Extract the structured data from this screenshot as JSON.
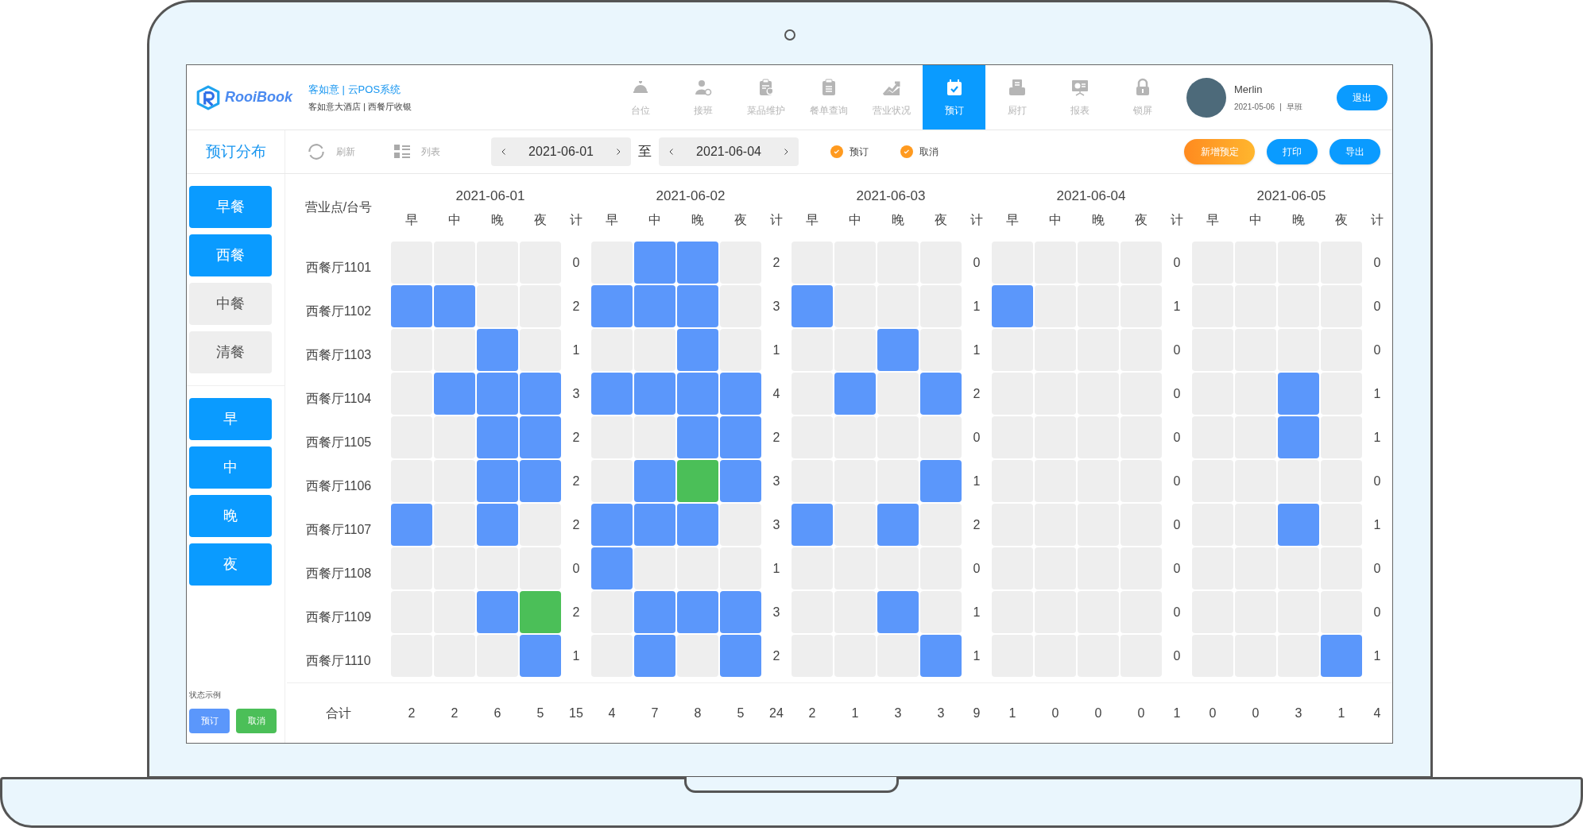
{
  "app": {
    "logo_text": "RooiBook",
    "title": "客如意 | 云POS系统",
    "subtitle": "客如意大酒店 | 西餐厅收银"
  },
  "nav": [
    {
      "label": "台位",
      "selected": false
    },
    {
      "label": "接班",
      "selected": false
    },
    {
      "label": "菜品维护",
      "selected": false
    },
    {
      "label": "餐单查询",
      "selected": false
    },
    {
      "label": "营业状况",
      "selected": false
    },
    {
      "label": "预订",
      "selected": true
    },
    {
      "label": "厨打",
      "selected": false
    },
    {
      "label": "报表",
      "selected": false
    },
    {
      "label": "锁屏",
      "selected": false
    }
  ],
  "user": {
    "name": "Merlin",
    "date": "2021-05-06",
    "separator": "|",
    "shift": "早班",
    "logout": "退出"
  },
  "page_title": "预订分布",
  "toolbar": {
    "refresh": "刷新",
    "list": "列表",
    "start_date": "2021-06-01",
    "to": "至",
    "end_date": "2021-06-04",
    "filters": [
      {
        "label": "预订",
        "checked": true
      },
      {
        "label": "取消",
        "checked": true
      }
    ],
    "buttons": [
      {
        "label": "新增预定",
        "kind": "accent"
      },
      {
        "label": "打印",
        "kind": "primary"
      },
      {
        "label": "导出",
        "kind": "primary"
      }
    ]
  },
  "sidebar": {
    "meals": [
      {
        "label": "早餐",
        "selected": true
      },
      {
        "label": "西餐",
        "selected": true
      },
      {
        "label": "中餐",
        "selected": false
      },
      {
        "label": "清餐",
        "selected": false
      }
    ],
    "shifts": [
      {
        "label": "早",
        "selected": true
      },
      {
        "label": "中",
        "selected": true
      },
      {
        "label": "晚",
        "selected": true
      },
      {
        "label": "夜",
        "selected": true
      }
    ],
    "legend_title": "状态示例",
    "legend": [
      {
        "label": "预订",
        "color": "#5b97fb"
      },
      {
        "label": "取消",
        "color": "#4bbf58"
      }
    ]
  },
  "grid": {
    "corner": "营业点/台号",
    "days": [
      {
        "date": "2021-06-01",
        "slots": [
          "早",
          "中",
          "晚",
          "夜"
        ],
        "total_label": "计"
      },
      {
        "date": "2021-06-02",
        "slots": [
          "早",
          "中",
          "晚",
          "夜"
        ],
        "total_label": "计"
      },
      {
        "date": "2021-06-03",
        "slots": [
          "早",
          "中",
          "晚",
          "夜"
        ],
        "total_label": "计"
      },
      {
        "date": "2021-06-04",
        "slots": [
          "早",
          "中",
          "晚",
          "夜"
        ],
        "total_label": "计"
      },
      {
        "date": "2021-06-05",
        "slots": [
          "早",
          "中",
          "晚",
          "夜"
        ],
        "total_label": "计"
      }
    ],
    "rows": [
      {
        "name": "西餐厅1101",
        "days": [
          {
            "slots": [
              {
                "kind": "free"
              },
              {
                "kind": "free"
              },
              {
                "kind": "free"
              },
              {
                "kind": "free"
              }
            ],
            "total": "0"
          },
          {
            "slots": [
              {
                "kind": "free"
              },
              {
                "kind": "booked"
              },
              {
                "kind": "booked"
              },
              {
                "kind": "free"
              }
            ],
            "total": "2"
          },
          {
            "slots": [
              {
                "kind": "free"
              },
              {
                "kind": "free"
              },
              {
                "kind": "free"
              },
              {
                "kind": "free"
              }
            ],
            "total": "0"
          },
          {
            "slots": [
              {
                "kind": "free"
              },
              {
                "kind": "free"
              },
              {
                "kind": "free"
              },
              {
                "kind": "free"
              }
            ],
            "total": "0"
          },
          {
            "slots": [
              {
                "kind": "free"
              },
              {
                "kind": "free"
              },
              {
                "kind": "free"
              },
              {
                "kind": "free"
              }
            ],
            "total": "0"
          }
        ]
      },
      {
        "name": "西餐厅1102",
        "days": [
          {
            "slots": [
              {
                "kind": "booked"
              },
              {
                "kind": "booked"
              },
              {
                "kind": "free"
              },
              {
                "kind": "free"
              }
            ],
            "total": "2"
          },
          {
            "slots": [
              {
                "kind": "booked"
              },
              {
                "kind": "booked"
              },
              {
                "kind": "booked"
              },
              {
                "kind": "free"
              }
            ],
            "total": "3"
          },
          {
            "slots": [
              {
                "kind": "booked"
              },
              {
                "kind": "free"
              },
              {
                "kind": "free"
              },
              {
                "kind": "free"
              }
            ],
            "total": "1"
          },
          {
            "slots": [
              {
                "kind": "booked"
              },
              {
                "kind": "free"
              },
              {
                "kind": "free"
              },
              {
                "kind": "free"
              }
            ],
            "total": "1"
          },
          {
            "slots": [
              {
                "kind": "free"
              },
              {
                "kind": "free"
              },
              {
                "kind": "free"
              },
              {
                "kind": "free"
              }
            ],
            "total": "0"
          }
        ]
      },
      {
        "name": "西餐厅1103",
        "days": [
          {
            "slots": [
              {
                "kind": "free"
              },
              {
                "kind": "free"
              },
              {
                "kind": "booked"
              },
              {
                "kind": "free"
              }
            ],
            "total": "1"
          },
          {
            "slots": [
              {
                "kind": "free"
              },
              {
                "kind": "free"
              },
              {
                "kind": "booked"
              },
              {
                "kind": "free"
              }
            ],
            "total": "1"
          },
          {
            "slots": [
              {
                "kind": "free"
              },
              {
                "kind": "free"
              },
              {
                "kind": "booked"
              },
              {
                "kind": "free"
              }
            ],
            "total": "1"
          },
          {
            "slots": [
              {
                "kind": "free"
              },
              {
                "kind": "free"
              },
              {
                "kind": "free"
              },
              {
                "kind": "free"
              }
            ],
            "total": "0"
          },
          {
            "slots": [
              {
                "kind": "free"
              },
              {
                "kind": "free"
              },
              {
                "kind": "free"
              },
              {
                "kind": "free"
              }
            ],
            "total": "0"
          }
        ]
      },
      {
        "name": "西餐厅1104",
        "days": [
          {
            "slots": [
              {
                "kind": "free"
              },
              {
                "kind": "booked"
              },
              {
                "kind": "booked"
              },
              {
                "kind": "booked"
              }
            ],
            "total": "3"
          },
          {
            "slots": [
              {
                "kind": "booked"
              },
              {
                "kind": "booked"
              },
              {
                "kind": "booked"
              },
              {
                "kind": "booked"
              }
            ],
            "total": "4"
          },
          {
            "slots": [
              {
                "kind": "free"
              },
              {
                "kind": "booked"
              },
              {
                "kind": "free"
              },
              {
                "kind": "booked"
              }
            ],
            "total": "2"
          },
          {
            "slots": [
              {
                "kind": "free"
              },
              {
                "kind": "free"
              },
              {
                "kind": "free"
              },
              {
                "kind": "free"
              }
            ],
            "total": "0"
          },
          {
            "slots": [
              {
                "kind": "free"
              },
              {
                "kind": "free"
              },
              {
                "kind": "booked"
              },
              {
                "kind": "free"
              }
            ],
            "total": "1"
          }
        ]
      },
      {
        "name": "西餐厅1105",
        "days": [
          {
            "slots": [
              {
                "kind": "free"
              },
              {
                "kind": "free"
              },
              {
                "kind": "booked"
              },
              {
                "kind": "booked"
              }
            ],
            "total": "2"
          },
          {
            "slots": [
              {
                "kind": "free"
              },
              {
                "kind": "free"
              },
              {
                "kind": "booked"
              },
              {
                "kind": "booked"
              }
            ],
            "total": "2"
          },
          {
            "slots": [
              {
                "kind": "free"
              },
              {
                "kind": "free"
              },
              {
                "kind": "free"
              },
              {
                "kind": "free"
              }
            ],
            "total": "0"
          },
          {
            "slots": [
              {
                "kind": "free"
              },
              {
                "kind": "free"
              },
              {
                "kind": "free"
              },
              {
                "kind": "free"
              }
            ],
            "total": "0"
          },
          {
            "slots": [
              {
                "kind": "free"
              },
              {
                "kind": "free"
              },
              {
                "kind": "booked"
              },
              {
                "kind": "free"
              }
            ],
            "total": "1"
          }
        ]
      },
      {
        "name": "西餐厅1106",
        "days": [
          {
            "slots": [
              {
                "kind": "free"
              },
              {
                "kind": "free"
              },
              {
                "kind": "booked"
              },
              {
                "kind": "booked"
              }
            ],
            "total": "2"
          },
          {
            "slots": [
              {
                "kind": "free"
              },
              {
                "kind": "booked"
              },
              {
                "kind": "cancelled"
              },
              {
                "kind": "booked"
              }
            ],
            "total": "3"
          },
          {
            "slots": [
              {
                "kind": "free"
              },
              {
                "kind": "free"
              },
              {
                "kind": "free"
              },
              {
                "kind": "booked"
              }
            ],
            "total": "1"
          },
          {
            "slots": [
              {
                "kind": "free"
              },
              {
                "kind": "free"
              },
              {
                "kind": "free"
              },
              {
                "kind": "free"
              }
            ],
            "total": "0"
          },
          {
            "slots": [
              {
                "kind": "free"
              },
              {
                "kind": "free"
              },
              {
                "kind": "free"
              },
              {
                "kind": "free"
              }
            ],
            "total": "0"
          }
        ]
      },
      {
        "name": "西餐厅1107",
        "days": [
          {
            "slots": [
              {
                "kind": "booked"
              },
              {
                "kind": "free"
              },
              {
                "kind": "booked"
              },
              {
                "kind": "free"
              }
            ],
            "total": "2"
          },
          {
            "slots": [
              {
                "kind": "booked"
              },
              {
                "kind": "booked"
              },
              {
                "kind": "booked"
              },
              {
                "kind": "free"
              }
            ],
            "total": "3"
          },
          {
            "slots": [
              {
                "kind": "booked"
              },
              {
                "kind": "free"
              },
              {
                "kind": "booked"
              },
              {
                "kind": "free"
              }
            ],
            "total": "2"
          },
          {
            "slots": [
              {
                "kind": "free"
              },
              {
                "kind": "free"
              },
              {
                "kind": "free"
              },
              {
                "kind": "free"
              }
            ],
            "total": "0"
          },
          {
            "slots": [
              {
                "kind": "free"
              },
              {
                "kind": "free"
              },
              {
                "kind": "booked"
              },
              {
                "kind": "free"
              }
            ],
            "total": "1"
          }
        ]
      },
      {
        "name": "西餐厅1108",
        "days": [
          {
            "slots": [
              {
                "kind": "free"
              },
              {
                "kind": "free"
              },
              {
                "kind": "free"
              },
              {
                "kind": "free"
              }
            ],
            "total": "0"
          },
          {
            "slots": [
              {
                "kind": "booked"
              },
              {
                "kind": "free"
              },
              {
                "kind": "free"
              },
              {
                "kind": "free"
              }
            ],
            "total": "1"
          },
          {
            "slots": [
              {
                "kind": "free"
              },
              {
                "kind": "free"
              },
              {
                "kind": "free"
              },
              {
                "kind": "free"
              }
            ],
            "total": "0"
          },
          {
            "slots": [
              {
                "kind": "free"
              },
              {
                "kind": "free"
              },
              {
                "kind": "free"
              },
              {
                "kind": "free"
              }
            ],
            "total": "0"
          },
          {
            "slots": [
              {
                "kind": "free"
              },
              {
                "kind": "free"
              },
              {
                "kind": "free"
              },
              {
                "kind": "free"
              }
            ],
            "total": "0"
          }
        ]
      },
      {
        "name": "西餐厅1109",
        "days": [
          {
            "slots": [
              {
                "kind": "free"
              },
              {
                "kind": "free"
              },
              {
                "kind": "booked"
              },
              {
                "kind": "cancelled"
              }
            ],
            "total": "2"
          },
          {
            "slots": [
              {
                "kind": "free"
              },
              {
                "kind": "booked"
              },
              {
                "kind": "booked"
              },
              {
                "kind": "booked"
              }
            ],
            "total": "3"
          },
          {
            "slots": [
              {
                "kind": "free"
              },
              {
                "kind": "free"
              },
              {
                "kind": "booked"
              },
              {
                "kind": "free"
              }
            ],
            "total": "1"
          },
          {
            "slots": [
              {
                "kind": "free"
              },
              {
                "kind": "free"
              },
              {
                "kind": "free"
              },
              {
                "kind": "free"
              }
            ],
            "total": "0"
          },
          {
            "slots": [
              {
                "kind": "free"
              },
              {
                "kind": "free"
              },
              {
                "kind": "free"
              },
              {
                "kind": "free"
              }
            ],
            "total": "0"
          }
        ]
      },
      {
        "name": "西餐厅1110",
        "days": [
          {
            "slots": [
              {
                "kind": "free"
              },
              {
                "kind": "free"
              },
              {
                "kind": "free"
              },
              {
                "kind": "booked"
              }
            ],
            "total": "1"
          },
          {
            "slots": [
              {
                "kind": "free"
              },
              {
                "kind": "booked"
              },
              {
                "kind": "free"
              },
              {
                "kind": "booked"
              }
            ],
            "total": "2"
          },
          {
            "slots": [
              {
                "kind": "free"
              },
              {
                "kind": "free"
              },
              {
                "kind": "free"
              },
              {
                "kind": "booked"
              }
            ],
            "total": "1"
          },
          {
            "slots": [
              {
                "kind": "free"
              },
              {
                "kind": "free"
              },
              {
                "kind": "free"
              },
              {
                "kind": "free"
              }
            ],
            "total": "0"
          },
          {
            "slots": [
              {
                "kind": "free"
              },
              {
                "kind": "free"
              },
              {
                "kind": "free"
              },
              {
                "kind": "booked"
              }
            ],
            "total": "1"
          }
        ]
      }
    ],
    "footer_label": "合计",
    "footer": [
      {
        "slots": [
          "2",
          "2",
          "6",
          "5"
        ],
        "total": "15"
      },
      {
        "slots": [
          "4",
          "7",
          "8",
          "5"
        ],
        "total": "24"
      },
      {
        "slots": [
          "2",
          "1",
          "3",
          "3"
        ],
        "total": "9"
      },
      {
        "slots": [
          "1",
          "0",
          "0",
          "0"
        ],
        "total": "1"
      },
      {
        "slots": [
          "0",
          "0",
          "3",
          "1"
        ],
        "total": "4"
      }
    ]
  }
}
